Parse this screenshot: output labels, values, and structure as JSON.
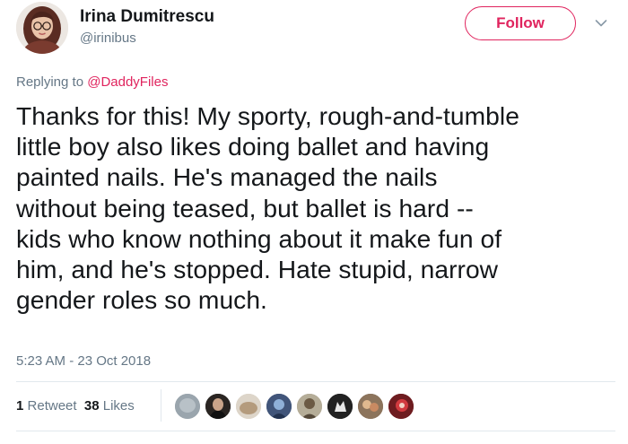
{
  "author": {
    "name": "Irina Dumitrescu",
    "handle": "@irinibus"
  },
  "follow": {
    "label": "Follow"
  },
  "icons": {
    "avatar": "user-avatar",
    "menu": "chevron-down-icon"
  },
  "reply": {
    "prefix": "Replying to ",
    "handle": "@DaddyFiles"
  },
  "tweet": {
    "lines": [
      "Thanks for this! My sporty, rough-and-tumble",
      "little boy also likes doing ballet and having",
      "painted nails. He's managed the nails",
      "without being teased, but ballet is hard --",
      "kids who know nothing about it make fun of",
      "him, and he's stopped. Hate stupid, narrow",
      "gender roles so much."
    ],
    "timestamp": "5:23 AM - 23 Oct 2018"
  },
  "stats": {
    "retweets_count": "1",
    "retweets_label": "Retweet",
    "likes_count": "38",
    "likes_label": "Likes"
  },
  "colors": {
    "accent": "#e0245e",
    "text": "#14171a",
    "secondary": "#657786",
    "divider": "#e1e8ed"
  }
}
